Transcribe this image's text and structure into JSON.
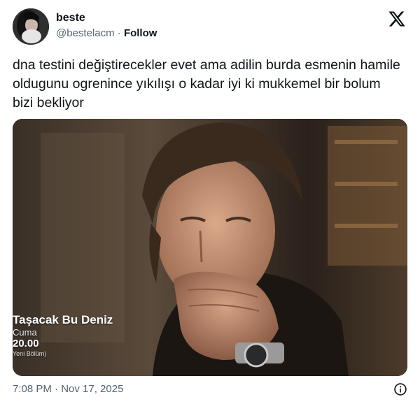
{
  "user": {
    "display_name": "beste",
    "handle": "@bestelacm",
    "separator": " · ",
    "follow_label": "Follow",
    "avatar_icon": "profile-photo"
  },
  "brand_icon": "x-logo-icon",
  "tweet": {
    "text": "dna testini değiştirecekler evet ama adilin burda esmenin hamile oldugunu ogrenince yıkılışı o kadar iyi ki mukkemel bir bolum bizi bekliyor"
  },
  "media": {
    "show_title": "Taşacak Bu Deniz",
    "show_day": "Cuma",
    "show_time": "20.00",
    "show_episode": "Yeni Bölüm)"
  },
  "footer": {
    "timestamp": "7:08 PM · Nov 17, 2025",
    "info_icon": "info-icon"
  },
  "colors": {
    "text_primary": "#0f1419",
    "text_secondary": "#536471",
    "background": "#ffffff"
  }
}
